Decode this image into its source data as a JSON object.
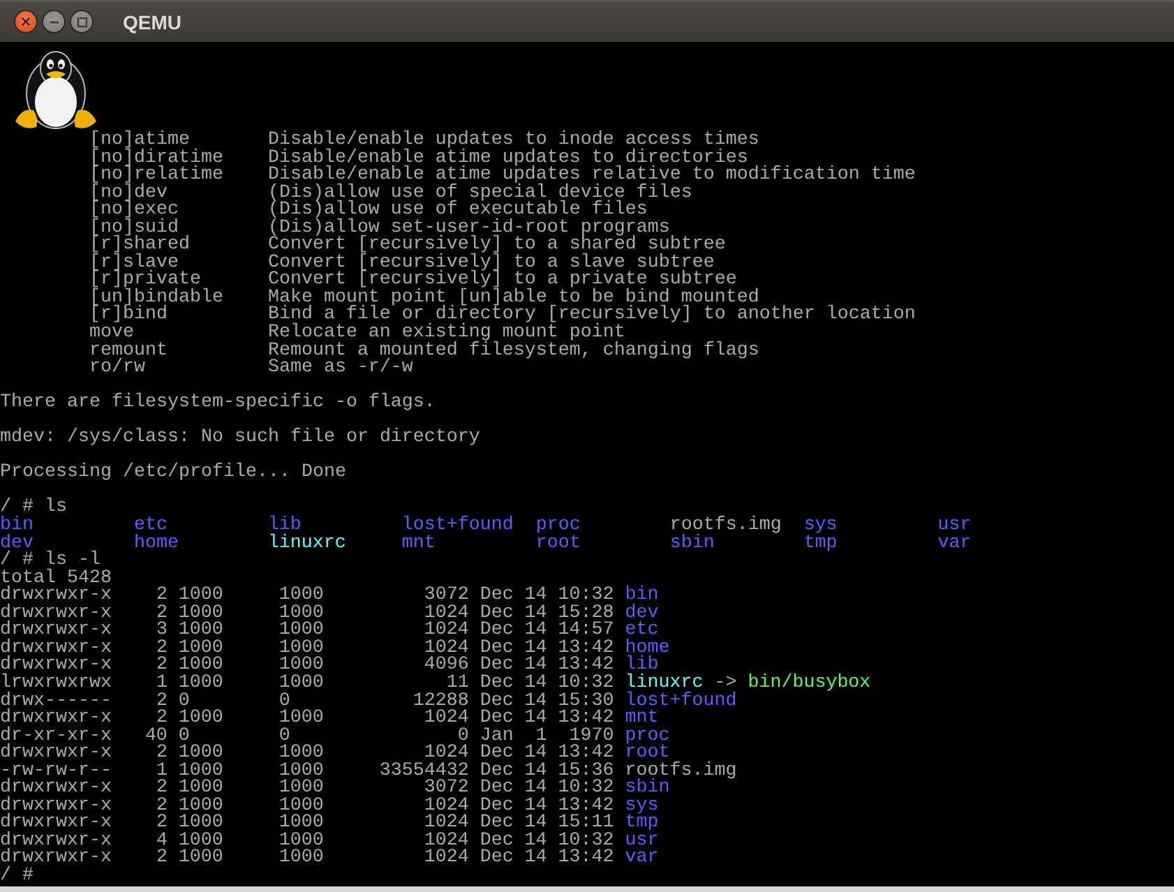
{
  "window": {
    "title": "QEMU"
  },
  "console": {
    "mount_options": [
      {
        "option": "[no]atime",
        "description": "Disable/enable updates to inode access times"
      },
      {
        "option": "[no]diratime",
        "description": "Disable/enable atime updates to directories"
      },
      {
        "option": "[no]relatime",
        "description": "Disable/enable atime updates relative to modification time"
      },
      {
        "option": "[no]dev",
        "description": "(Dis)allow use of special device files"
      },
      {
        "option": "[no]exec",
        "description": "(Dis)allow use of executable files"
      },
      {
        "option": "[no]suid",
        "description": "(Dis)allow set-user-id-root programs"
      },
      {
        "option": "[r]shared",
        "description": "Convert [recursively] to a shared subtree"
      },
      {
        "option": "[r]slave",
        "description": "Convert [recursively] to a slave subtree"
      },
      {
        "option": "[r]private",
        "description": "Convert [recursively] to a private subtree"
      },
      {
        "option": "[un]bindable",
        "description": "Make mount point [un]able to be bind mounted"
      },
      {
        "option": "[r]bind",
        "description": "Bind a file or directory [recursively] to another location"
      },
      {
        "option": "move",
        "description": "Relocate an existing mount point"
      },
      {
        "option": "remount",
        "description": "Remount a mounted filesystem, changing flags"
      },
      {
        "option": "ro/rw",
        "description": "Same as -r/-w"
      }
    ],
    "messages": [
      "There are filesystem-specific -o flags.",
      "mdev: /sys/class: No such file or directory",
      "Processing /etc/profile... Done"
    ],
    "ls": {
      "command": "/ # ls",
      "entries": [
        {
          "name": "bin",
          "kind": "dir"
        },
        {
          "name": "etc",
          "kind": "dir"
        },
        {
          "name": "lib",
          "kind": "dir"
        },
        {
          "name": "lost+found",
          "kind": "dir"
        },
        {
          "name": "proc",
          "kind": "dir"
        },
        {
          "name": "rootfs.img",
          "kind": "file"
        },
        {
          "name": "sys",
          "kind": "dir"
        },
        {
          "name": "usr",
          "kind": "dir"
        },
        {
          "name": "dev",
          "kind": "dir"
        },
        {
          "name": "home",
          "kind": "dir"
        },
        {
          "name": "linuxrc",
          "kind": "link"
        },
        {
          "name": "mnt",
          "kind": "dir"
        },
        {
          "name": "root",
          "kind": "dir"
        },
        {
          "name": "sbin",
          "kind": "dir"
        },
        {
          "name": "tmp",
          "kind": "dir"
        },
        {
          "name": "var",
          "kind": "dir"
        }
      ]
    },
    "ls_long": {
      "command": "/ # ls -l",
      "total": "total 5428",
      "rows": [
        {
          "perms": "drwxrwxr-x",
          "links": "2",
          "owner": "1000",
          "group": "1000",
          "size": "3072",
          "month": "Dec",
          "day": "14",
          "time": "10:32",
          "name": "bin",
          "kind": "dir"
        },
        {
          "perms": "drwxrwxr-x",
          "links": "2",
          "owner": "1000",
          "group": "1000",
          "size": "1024",
          "month": "Dec",
          "day": "14",
          "time": "15:28",
          "name": "dev",
          "kind": "dir"
        },
        {
          "perms": "drwxrwxr-x",
          "links": "3",
          "owner": "1000",
          "group": "1000",
          "size": "1024",
          "month": "Dec",
          "day": "14",
          "time": "14:57",
          "name": "etc",
          "kind": "dir"
        },
        {
          "perms": "drwxrwxr-x",
          "links": "2",
          "owner": "1000",
          "group": "1000",
          "size": "1024",
          "month": "Dec",
          "day": "14",
          "time": "13:42",
          "name": "home",
          "kind": "dir"
        },
        {
          "perms": "drwxrwxr-x",
          "links": "2",
          "owner": "1000",
          "group": "1000",
          "size": "4096",
          "month": "Dec",
          "day": "14",
          "time": "13:42",
          "name": "lib",
          "kind": "dir"
        },
        {
          "perms": "lrwxrwxrwx",
          "links": "1",
          "owner": "1000",
          "group": "1000",
          "size": "11",
          "month": "Dec",
          "day": "14",
          "time": "10:32",
          "name": "linuxrc",
          "kind": "link",
          "arrow": "->",
          "target": "bin/busybox"
        },
        {
          "perms": "drwx------",
          "links": "2",
          "owner": "0",
          "group": "0",
          "size": "12288",
          "month": "Dec",
          "day": "14",
          "time": "15:30",
          "name": "lost+found",
          "kind": "dir"
        },
        {
          "perms": "drwxrwxr-x",
          "links": "2",
          "owner": "1000",
          "group": "1000",
          "size": "1024",
          "month": "Dec",
          "day": "14",
          "time": "13:42",
          "name": "mnt",
          "kind": "dir"
        },
        {
          "perms": "dr-xr-xr-x",
          "links": "40",
          "owner": "0",
          "group": "0",
          "size": "0",
          "month": "Jan",
          "day": "1",
          "time": "1970",
          "name": "proc",
          "kind": "dir"
        },
        {
          "perms": "drwxrwxr-x",
          "links": "2",
          "owner": "1000",
          "group": "1000",
          "size": "1024",
          "month": "Dec",
          "day": "14",
          "time": "13:42",
          "name": "root",
          "kind": "dir"
        },
        {
          "perms": "-rw-rw-r--",
          "links": "1",
          "owner": "1000",
          "group": "1000",
          "size": "33554432",
          "month": "Dec",
          "day": "14",
          "time": "15:36",
          "name": "rootfs.img",
          "kind": "file"
        },
        {
          "perms": "drwxrwxr-x",
          "links": "2",
          "owner": "1000",
          "group": "1000",
          "size": "3072",
          "month": "Dec",
          "day": "14",
          "time": "10:32",
          "name": "sbin",
          "kind": "dir"
        },
        {
          "perms": "drwxrwxr-x",
          "links": "2",
          "owner": "1000",
          "group": "1000",
          "size": "1024",
          "month": "Dec",
          "day": "14",
          "time": "13:42",
          "name": "sys",
          "kind": "dir"
        },
        {
          "perms": "drwxrwxr-x",
          "links": "2",
          "owner": "1000",
          "group": "1000",
          "size": "1024",
          "month": "Dec",
          "day": "14",
          "time": "15:11",
          "name": "tmp",
          "kind": "dir"
        },
        {
          "perms": "drwxrwxr-x",
          "links": "4",
          "owner": "1000",
          "group": "1000",
          "size": "1024",
          "month": "Dec",
          "day": "14",
          "time": "10:32",
          "name": "usr",
          "kind": "dir"
        },
        {
          "perms": "drwxrwxr-x",
          "links": "2",
          "owner": "1000",
          "group": "1000",
          "size": "1024",
          "month": "Dec",
          "day": "14",
          "time": "13:42",
          "name": "var",
          "kind": "dir"
        }
      ]
    },
    "prompt": "/ #"
  }
}
